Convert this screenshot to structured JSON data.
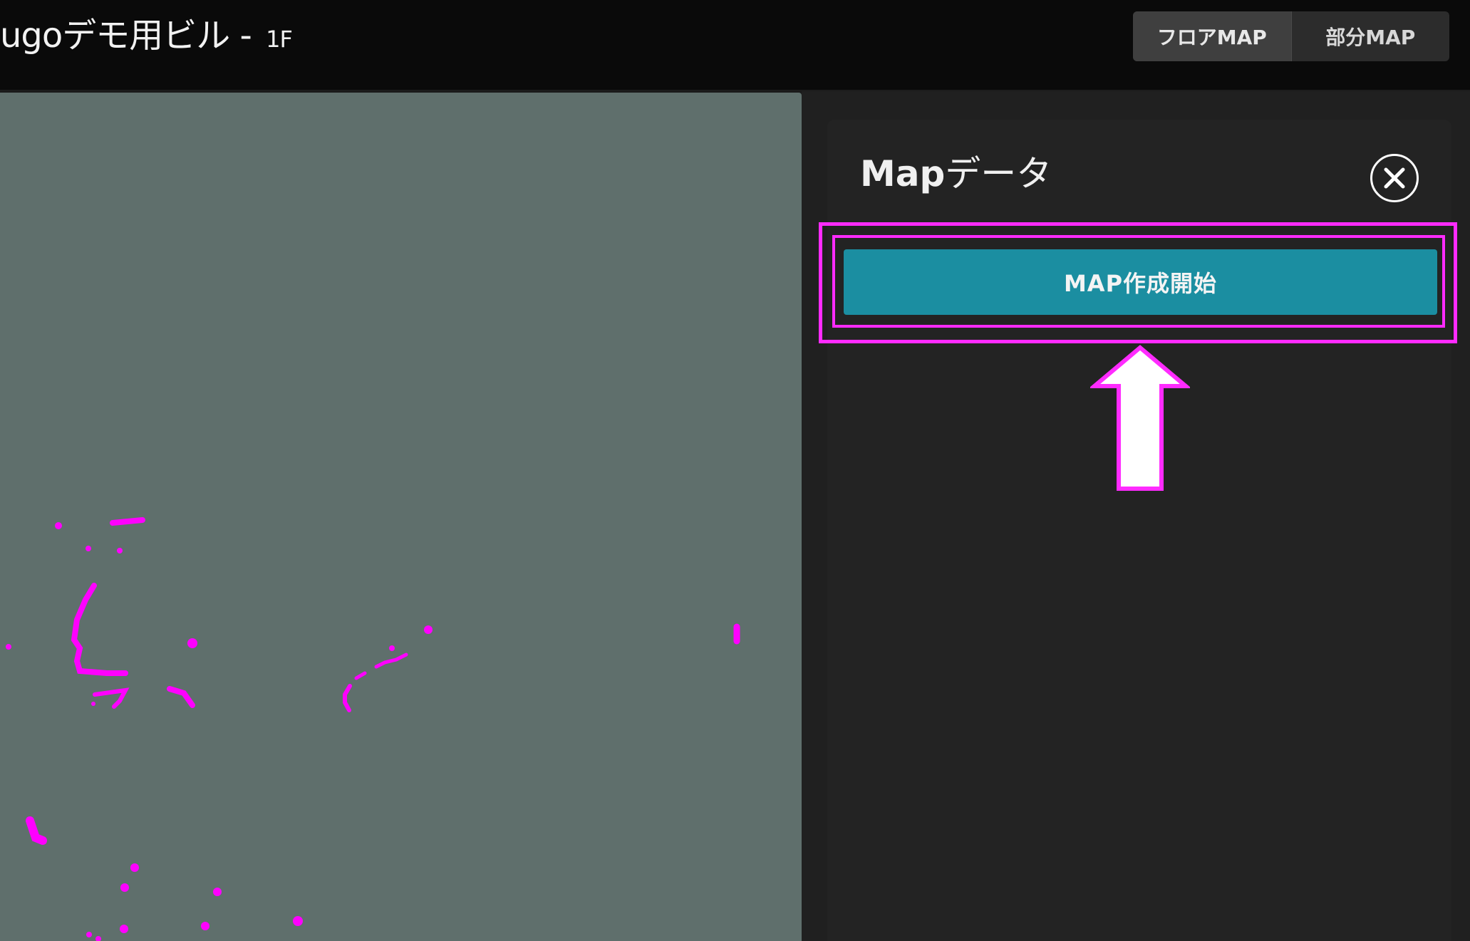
{
  "header": {
    "building_title": "ugoデモ用ビル - ",
    "floor": "1F",
    "toggle": {
      "floor_map": "フロアMAP",
      "partial_map": "部分MAP",
      "active": "floor_map"
    }
  },
  "panel": {
    "title_en": "Map",
    "title_jp": "データ",
    "close_icon": "close-icon",
    "start_button": "MAP作成開始"
  },
  "annotation": {
    "color": "#ff2bff",
    "arrow_icon": "up-arrow-icon"
  },
  "colors": {
    "map_bg": "#5f6f6c",
    "button": "#1b8ea1",
    "scan_points": "#ff00ff"
  }
}
